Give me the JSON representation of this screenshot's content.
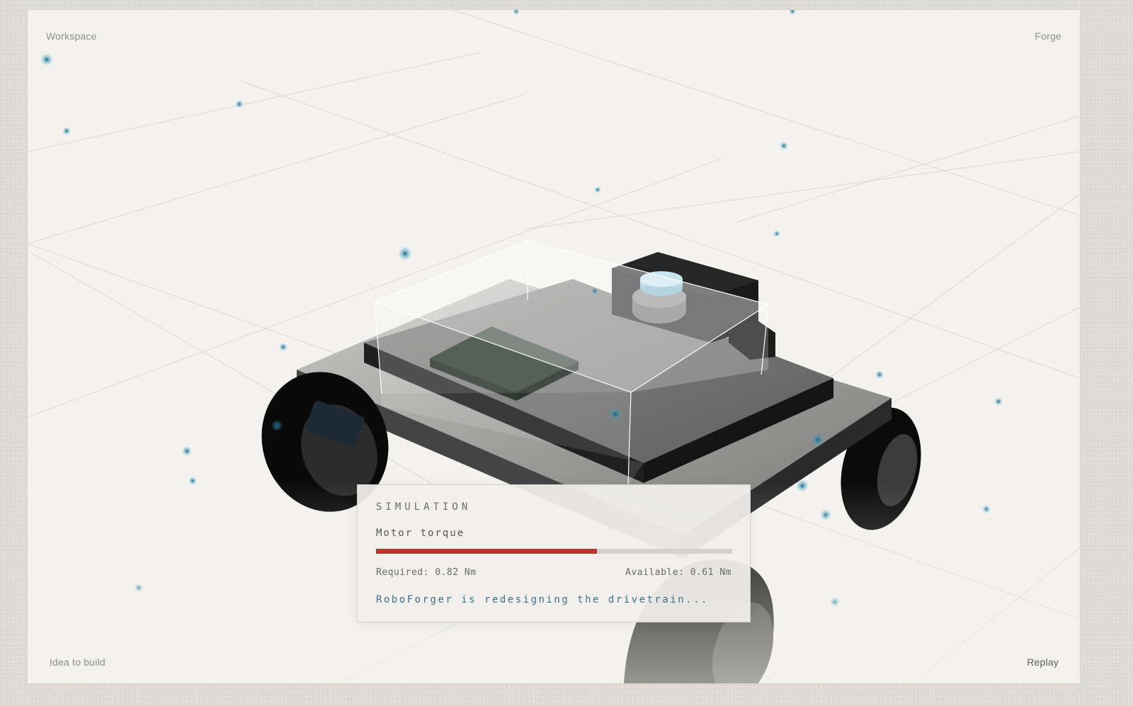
{
  "workspace": {
    "label_top_left": "Workspace",
    "label_top_right": "Forge",
    "label_bottom_left": "Idea to build",
    "replay_label": "Replay"
  },
  "simulation": {
    "title": "SIMULATION",
    "metric_label": "Motor torque",
    "progress_fraction": 0.62,
    "required_text": "Required: 0.82 Nm",
    "available_text": "Available: 0.61 Nm",
    "status_text": "RoboForger is redesigning the drivetrain...",
    "bar_color": "#b5352d",
    "status_color": "#3f6f84"
  },
  "colors": {
    "background": "#f3f2ee",
    "particle": "#1f6e8c",
    "robot_body": "#8a8a8a",
    "wheel": "#0d0d0d",
    "circuit_board": "#24352b",
    "sensor_cap": "#8fc4d8"
  }
}
